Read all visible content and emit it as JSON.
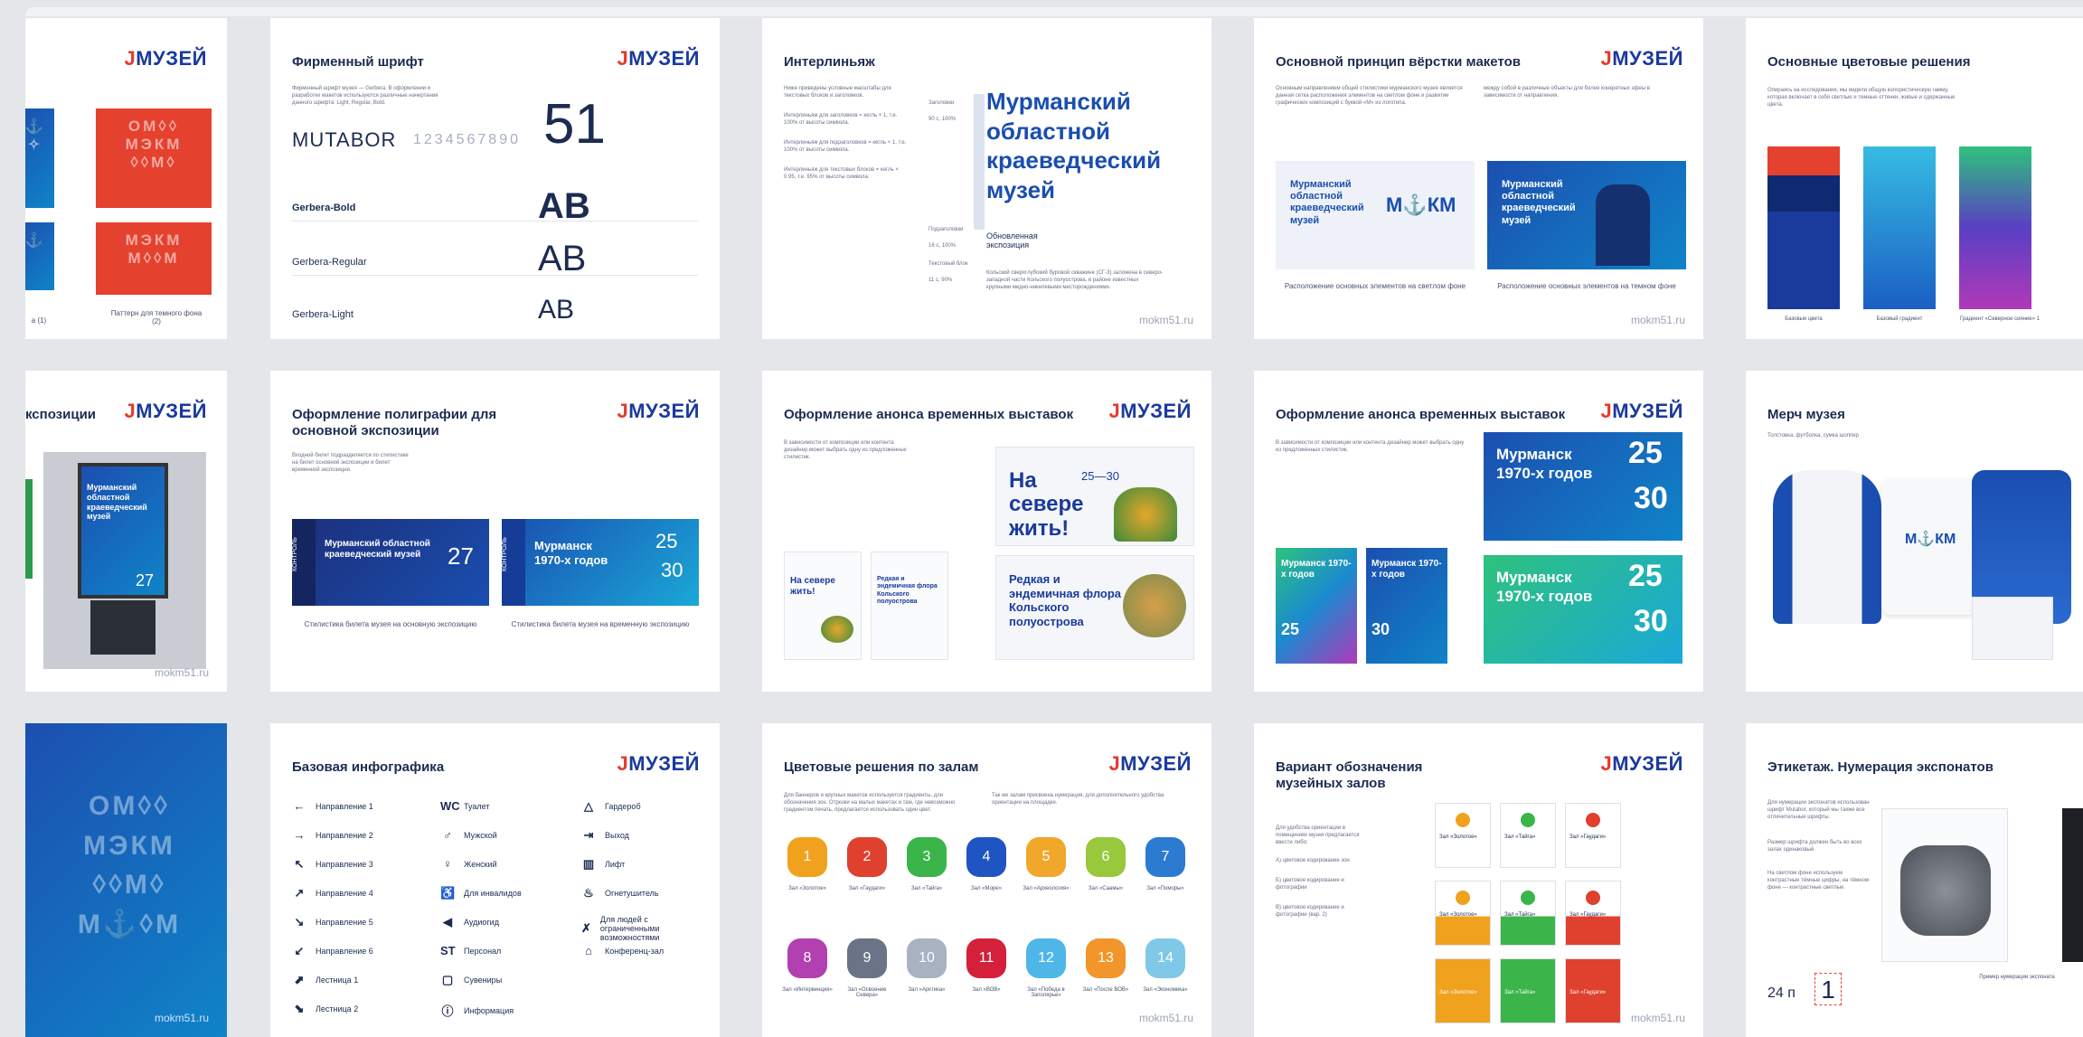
{
  "brand": {
    "logo": "МУЗЕЙ",
    "site": "mokm51.ru"
  },
  "row1": {
    "s1": {
      "caption_left": "а (1)",
      "caption_right": "Паттерн для темного фона (2)",
      "pattern": [
        "ОМ◊◊",
        "МЭКМ",
        "◊◊М◊",
        "М◊◊М"
      ]
    },
    "s2": {
      "title": "Фирменный шрифт",
      "fonts": [
        "MUTABOR",
        "Gerbera-Bold",
        "Gerbera-Regular",
        "Gerbera-Light"
      ],
      "digits": "1234567890",
      "big_num": "51",
      "samples": [
        "AB",
        "AB",
        "AB"
      ]
    },
    "s3": {
      "title": "Интерлиньяж",
      "heading": "Мурманский областной краеведческий музей",
      "sub": "Обновленная экспозиция",
      "lbl1": "Заголовки",
      "val1": "90 с, 100%",
      "lbl2": "Подзаголовки",
      "val2": "16 с, 100%",
      "lbl3": "Текстовый блок",
      "val3": "11 с, 90%"
    },
    "s4": {
      "title": "Основной принцип вёрстки макетов",
      "card_text": "Мурманский областной краеведческий музей",
      "card_mark": "М⚓КМ",
      "cap_left": "Расположение основных элементов на светлом фоне",
      "cap_right": "Расположение основных элементов на темном фоне"
    },
    "s5": {
      "title": "Основные цветовые решения",
      "cap1": "Базовые цвета",
      "cap2": "Базовый градиент",
      "cap3": "Градиент «Северное сияние» 1"
    }
  },
  "row2": {
    "s1": {
      "title": "кспозиции",
      "board": "Мурманский областной краеведческий музей",
      "num": "27"
    },
    "s2": {
      "title": "Оформление полиграфии для основной экспозиции",
      "desc": "Входной билет подразделяется по стилистике на билет основной экспозиции и билет временной экспозиции.",
      "t1": "Мурманский областной краеведческий музей",
      "n1": "27",
      "t2": "Мурманск 1970-х годов",
      "n2a": "25",
      "n2b": "30",
      "kontrol": "КОНТРОЛЬ",
      "cap1": "Стилистика билета музея на основную экспозицию",
      "cap2": "Стилистика билета музея на временную экспозицию"
    },
    "s3": {
      "title": "Оформление анонса временных выставок",
      "p1": "На севере жить!",
      "p1num": "25—30",
      "p2": "Редкая и эндемичная флора Кольского полуострова"
    },
    "s4": {
      "title": "Оформление анонса временных выставок",
      "p": "Мурманск 1970-х годов",
      "na": "25",
      "nb": "30"
    },
    "s5": {
      "title": "Мерч музея",
      "sub": "Толстовка, футболка, сумка шоппер",
      "mark": "М⚓КМ"
    }
  },
  "row3": {
    "s1": {
      "pattern": [
        "ОМ◊◊",
        "МЭКМ",
        "◊◊М◊",
        "М⚓◊М"
      ],
      "url": "mokm51.ru"
    },
    "s2": {
      "title": "Базовая инфографика",
      "col1": [
        "Направление 1",
        "Направление 2",
        "Направление 3",
        "Направление 4",
        "Направление 5",
        "Направление 6",
        "Лестница 1",
        "Лестница 2"
      ],
      "col1_icons": [
        "←",
        "→",
        "↖",
        "↗",
        "↘",
        "↙",
        "⬈",
        "⬊"
      ],
      "col2": [
        "Туалет",
        "Мужской",
        "Женский",
        "Для инвалидов",
        "Аудиогид",
        "Персонал",
        "Сувениры",
        "Информация"
      ],
      "col2_icons": [
        "WC",
        "♂",
        "♀",
        "♿",
        "◀",
        "ST",
        "▢",
        "ⓘ"
      ],
      "col3": [
        "Гардероб",
        "Выход",
        "Лифт",
        "Огнетушитель",
        "Для людей с ограниченными возможностями",
        "Конференц-зал"
      ],
      "col3_icons": [
        "△",
        "⇥",
        "▥",
        "♨",
        "✗",
        "⌂"
      ]
    },
    "s3": {
      "title": "Цветовые решения по залам",
      "nums": [
        "1",
        "2",
        "3",
        "4",
        "5",
        "6",
        "7",
        "8",
        "9",
        "10",
        "11",
        "12",
        "13",
        "14"
      ],
      "colors": [
        "#f0a21e",
        "#e0402e",
        "#3bb54a",
        "#1f55c2",
        "#f1a72a",
        "#98c83c",
        "#2b7bd2",
        "#b240b0",
        "#6a7486",
        "#a8b2c0",
        "#d4203a",
        "#4fb6e8",
        "#f2952a",
        "#7fc8e8"
      ],
      "caps": [
        "Зал «Золотое»",
        "Зал «Гаудаги»",
        "Зал «Тайга»",
        "Зал «Море»",
        "Зал «Археология»",
        "Зал «Саамы»",
        "Зал «Поморы»",
        "Зал «Интервенция»",
        "Зал «Освоение Севера»",
        "Зал «Арктика»",
        "Зал «ВОВ»",
        "Зал «Победа в Заполярье»",
        "Зал «После ВОВ»",
        "Зал «Экономика»"
      ]
    },
    "s4": {
      "title": "Вариант обозначения музейных залов",
      "labels": [
        "Зал «Золотое»",
        "Зал «Тайга»",
        "Зал «Гаудаги»"
      ]
    },
    "s5": {
      "title": "Этикетаж. Нумерация экспонатов",
      "sample": "24 п",
      "num": "1",
      "caption": "Пример нумерации экспоната"
    }
  },
  "colors": {
    "brand_blue": "#1a3a9c",
    "brand_red": "#e53a2c",
    "pattern_red": "#e5412f"
  }
}
